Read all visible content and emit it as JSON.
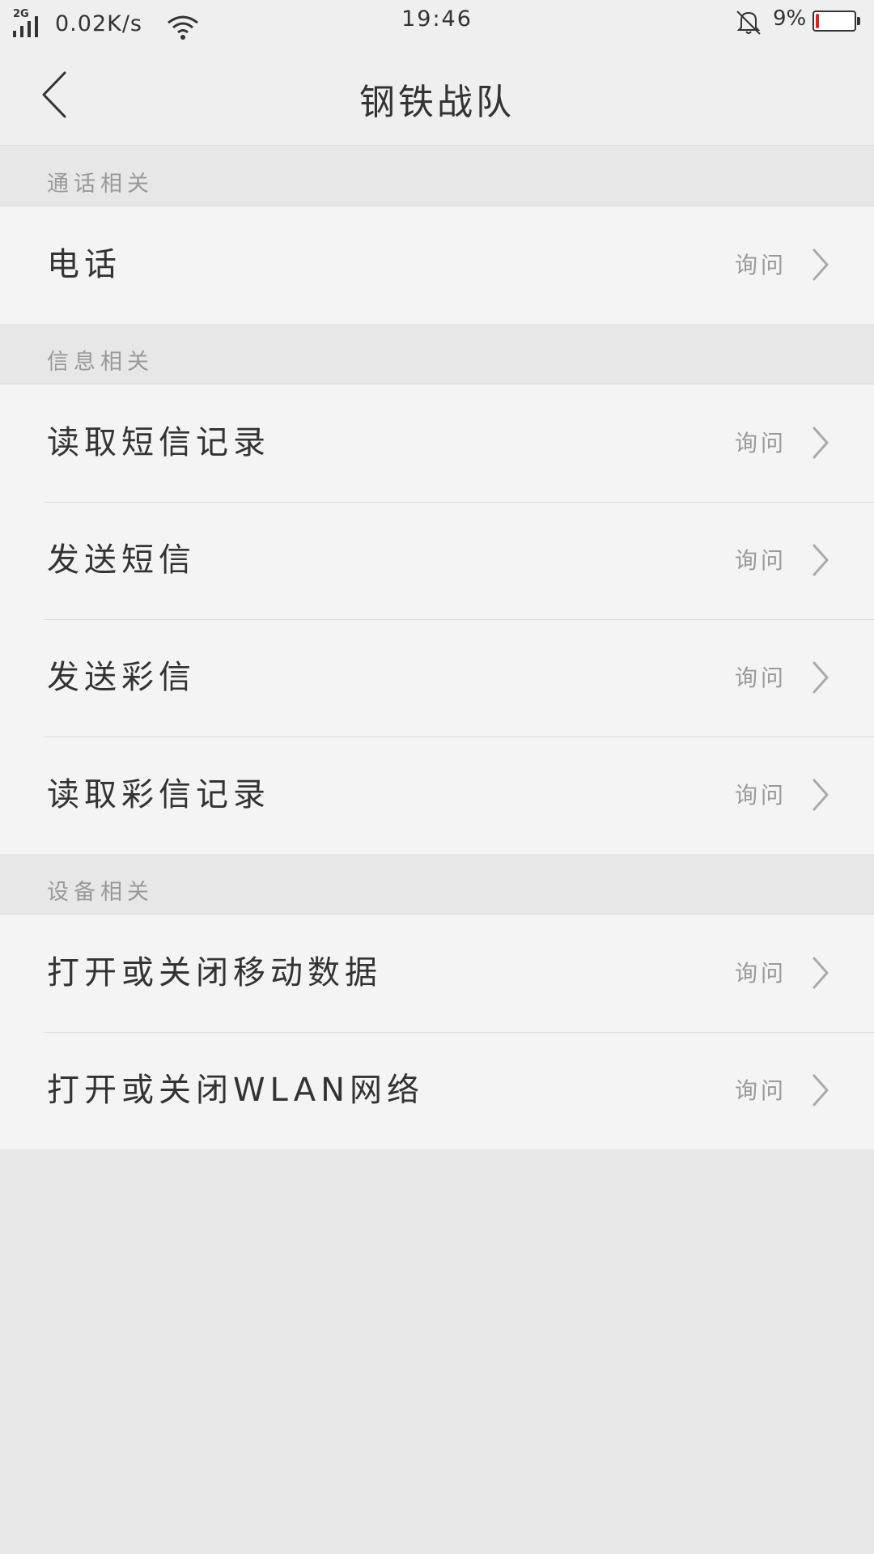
{
  "status_bar": {
    "network_type": "2G",
    "speed": "0.02K/s",
    "time": "19:46",
    "battery_percent": "9%",
    "battery_level": 0.09,
    "battery_color": "#e32020",
    "icons": [
      "signal-icon",
      "wifi-icon",
      "bell-muted-icon",
      "battery-icon"
    ]
  },
  "header": {
    "title": "钢铁战队",
    "back_icon": "back-arrow-icon"
  },
  "sections": [
    {
      "title": "通话相关",
      "items": [
        {
          "label": "电话",
          "value": "询问"
        }
      ]
    },
    {
      "title": "信息相关",
      "items": [
        {
          "label": "读取短信记录",
          "value": "询问"
        },
        {
          "label": "发送短信",
          "value": "询问"
        },
        {
          "label": "发送彩信",
          "value": "询问"
        },
        {
          "label": "读取彩信记录",
          "value": "询问"
        }
      ]
    },
    {
      "title": "设备相关",
      "items": [
        {
          "label": "打开或关闭移动数据",
          "value": "询问"
        },
        {
          "label": "打开或关闭WLAN网络",
          "value": "询问"
        }
      ]
    }
  ]
}
